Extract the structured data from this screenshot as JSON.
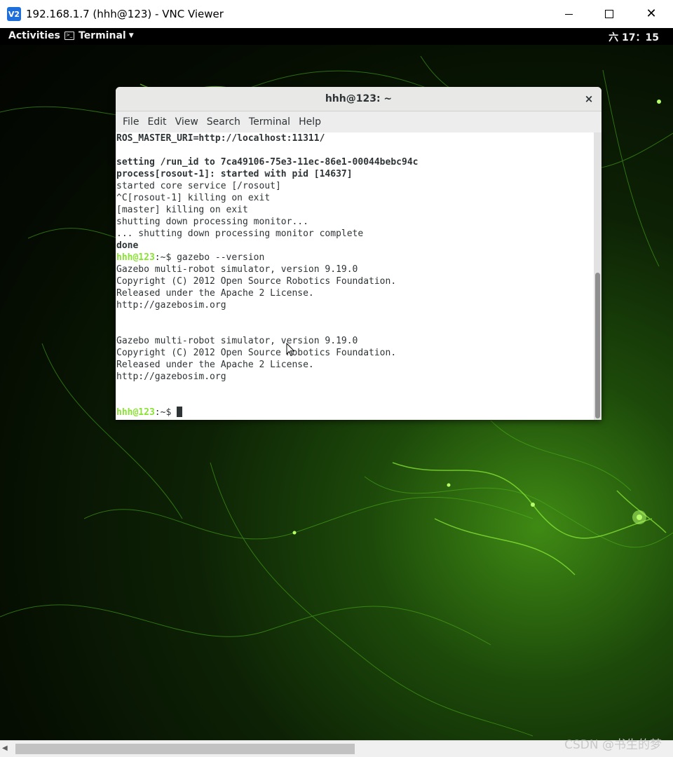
{
  "vnc": {
    "title": "192.168.1.7 (hhh@123) - VNC Viewer",
    "logo_text": "V2"
  },
  "gnome": {
    "activities": "Activities",
    "app_name": "Terminal",
    "clock": "六 17：15"
  },
  "terminal": {
    "title": "hhh@123: ~",
    "menu": [
      "File",
      "Edit",
      "View",
      "Search",
      "Terminal",
      "Help"
    ],
    "lines": [
      {
        "text": "ROS_MASTER_URI=http://localhost:11311/",
        "bold": true
      },
      {
        "text": "",
        "bold": false
      },
      {
        "text": "setting /run_id to 7ca49106-75e3-11ec-86e1-00044bebc94c",
        "bold": true
      },
      {
        "text": "process[rosout-1]: started with pid [14637]",
        "bold": true
      },
      {
        "text": "started core service [/rosout]",
        "bold": false
      },
      {
        "text": "^C[rosout-1] killing on exit",
        "bold": false
      },
      {
        "text": "[master] killing on exit",
        "bold": false
      },
      {
        "text": "shutting down processing monitor...",
        "bold": false
      },
      {
        "text": "... shutting down processing monitor complete",
        "bold": false
      },
      {
        "text": "done",
        "bold": true
      },
      {
        "prompt": "hhh@123",
        "path": ":~$ ",
        "command": "gazebo --version"
      },
      {
        "text": "Gazebo multi-robot simulator, version 9.19.0",
        "bold": false
      },
      {
        "text": "Copyright (C) 2012 Open Source Robotics Foundation.",
        "bold": false
      },
      {
        "text": "Released under the Apache 2 License.",
        "bold": false
      },
      {
        "text": "http://gazebosim.org",
        "bold": false
      },
      {
        "text": "",
        "bold": false
      },
      {
        "text": "",
        "bold": false
      },
      {
        "text": "Gazebo multi-robot simulator, version 9.19.0",
        "bold": false
      },
      {
        "text": "Copyright (C) 2012 Open Source Robotics Foundation.",
        "bold": false
      },
      {
        "text": "Released under the Apache 2 License.",
        "bold": false
      },
      {
        "text": "http://gazebosim.org",
        "bold": false
      },
      {
        "text": "",
        "bold": false
      },
      {
        "text": "",
        "bold": false
      },
      {
        "prompt": "hhh@123",
        "path": ":~$ ",
        "command": "",
        "cursor": true
      }
    ]
  },
  "watermark": "CSDN @书生的梦",
  "icons": {
    "close": "close-icon",
    "terminal_app": "terminal-app-icon",
    "pointer": "mouse-pointer-icon"
  }
}
